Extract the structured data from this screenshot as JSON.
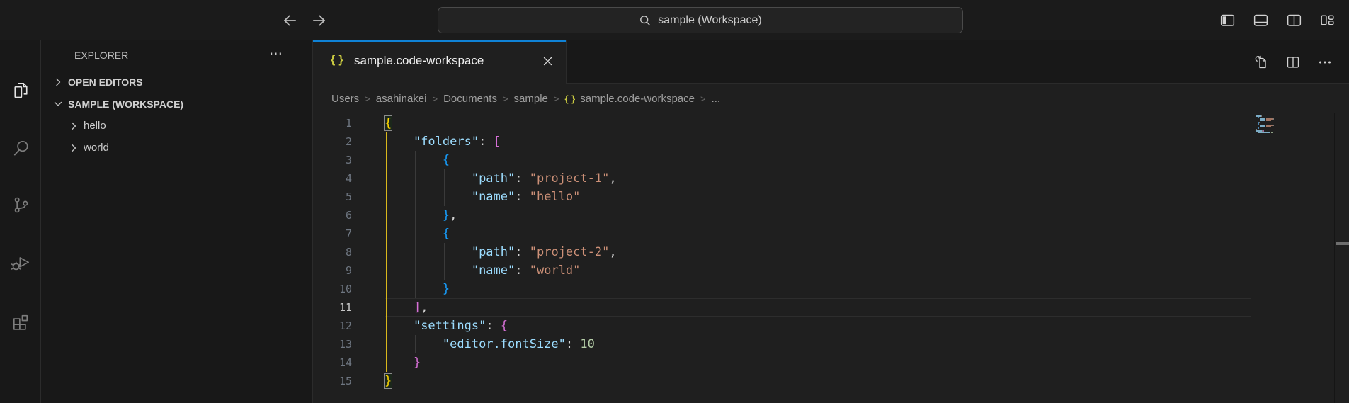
{
  "colors": {
    "accent_blue": "#0f82d6",
    "background_editor": "#1f1f1f",
    "background_shell": "#181818",
    "json_icon": "#cbcb41",
    "token_key": "#9cdcfe",
    "token_string": "#ce9178",
    "token_number": "#b5cea8",
    "bracket_yellow": "#ffd700",
    "bracket_pink": "#d670d6",
    "bracket_blue": "#179fff"
  },
  "title_bar": {
    "command_center_label": "sample (Workspace)",
    "layout_icons": [
      "toggle-primary-sidebar",
      "toggle-panel",
      "toggle-secondary-sidebar",
      "customize-layout"
    ]
  },
  "activity_bar": {
    "items": [
      {
        "name": "explorer",
        "active": true
      },
      {
        "name": "search",
        "active": false
      },
      {
        "name": "source-control",
        "active": false
      },
      {
        "name": "run-debug",
        "active": false
      },
      {
        "name": "extensions",
        "active": false
      }
    ]
  },
  "sidebar": {
    "title": "EXPLORER",
    "sections": [
      {
        "label": "OPEN EDITORS",
        "expanded": false,
        "items": []
      },
      {
        "label": "SAMPLE (WORKSPACE)",
        "expanded": true,
        "items": [
          {
            "label": "hello",
            "expanded": false
          },
          {
            "label": "world",
            "expanded": false
          }
        ]
      }
    ]
  },
  "editor": {
    "tab": {
      "label": "sample.code-workspace",
      "icon": "json-braces",
      "active": true
    },
    "actions": [
      "open-changes",
      "split-editor",
      "more-actions"
    ],
    "breadcrumbs": [
      {
        "label": "Users"
      },
      {
        "label": "asahinakei"
      },
      {
        "label": "Documents"
      },
      {
        "label": "sample"
      },
      {
        "label": "sample.code-workspace",
        "icon": "json-braces"
      },
      {
        "label": "..."
      }
    ],
    "code": {
      "language": "json",
      "current_line": 11,
      "lines": [
        {
          "n": 1,
          "guides": [],
          "tokens": [
            {
              "t": "{",
              "c": "by",
              "box": true
            }
          ]
        },
        {
          "n": 2,
          "guides": [
            {
              "col": 0,
              "active": true
            }
          ],
          "tokens": [
            {
              "t": "    "
            },
            {
              "t": "\"folders\"",
              "c": "key"
            },
            {
              "t": ":",
              "c": "pun"
            },
            {
              "t": " "
            },
            {
              "t": "[",
              "c": "bp"
            }
          ]
        },
        {
          "n": 3,
          "guides": [
            {
              "col": 0,
              "active": true
            },
            {
              "col": 4,
              "active": false
            }
          ],
          "tokens": [
            {
              "t": "        "
            },
            {
              "t": "{",
              "c": "bb"
            }
          ]
        },
        {
          "n": 4,
          "guides": [
            {
              "col": 0,
              "active": true
            },
            {
              "col": 4,
              "active": false
            },
            {
              "col": 8,
              "active": false
            }
          ],
          "tokens": [
            {
              "t": "            "
            },
            {
              "t": "\"path\"",
              "c": "key"
            },
            {
              "t": ":",
              "c": "pun"
            },
            {
              "t": " "
            },
            {
              "t": "\"project-1\"",
              "c": "str"
            },
            {
              "t": ",",
              "c": "pun"
            }
          ]
        },
        {
          "n": 5,
          "guides": [
            {
              "col": 0,
              "active": true
            },
            {
              "col": 4,
              "active": false
            },
            {
              "col": 8,
              "active": false
            }
          ],
          "tokens": [
            {
              "t": "            "
            },
            {
              "t": "\"name\"",
              "c": "key"
            },
            {
              "t": ":",
              "c": "pun"
            },
            {
              "t": " "
            },
            {
              "t": "\"hello\"",
              "c": "str"
            }
          ]
        },
        {
          "n": 6,
          "guides": [
            {
              "col": 0,
              "active": true
            },
            {
              "col": 4,
              "active": false
            }
          ],
          "tokens": [
            {
              "t": "        "
            },
            {
              "t": "}",
              "c": "bb"
            },
            {
              "t": ",",
              "c": "pun"
            }
          ]
        },
        {
          "n": 7,
          "guides": [
            {
              "col": 0,
              "active": true
            },
            {
              "col": 4,
              "active": false
            }
          ],
          "tokens": [
            {
              "t": "        "
            },
            {
              "t": "{",
              "c": "bb"
            }
          ]
        },
        {
          "n": 8,
          "guides": [
            {
              "col": 0,
              "active": true
            },
            {
              "col": 4,
              "active": false
            },
            {
              "col": 8,
              "active": false
            }
          ],
          "tokens": [
            {
              "t": "            "
            },
            {
              "t": "\"path\"",
              "c": "key"
            },
            {
              "t": ":",
              "c": "pun"
            },
            {
              "t": " "
            },
            {
              "t": "\"project-2\"",
              "c": "str"
            },
            {
              "t": ",",
              "c": "pun"
            }
          ]
        },
        {
          "n": 9,
          "guides": [
            {
              "col": 0,
              "active": true
            },
            {
              "col": 4,
              "active": false
            },
            {
              "col": 8,
              "active": false
            }
          ],
          "tokens": [
            {
              "t": "            "
            },
            {
              "t": "\"name\"",
              "c": "key"
            },
            {
              "t": ":",
              "c": "pun"
            },
            {
              "t": " "
            },
            {
              "t": "\"world\"",
              "c": "str"
            }
          ]
        },
        {
          "n": 10,
          "guides": [
            {
              "col": 0,
              "active": true
            },
            {
              "col": 4,
              "active": false
            }
          ],
          "tokens": [
            {
              "t": "        "
            },
            {
              "t": "}",
              "c": "bb"
            }
          ]
        },
        {
          "n": 11,
          "guides": [
            {
              "col": 0,
              "active": true
            }
          ],
          "tokens": [
            {
              "t": "    "
            },
            {
              "t": "]",
              "c": "bp"
            },
            {
              "t": ",",
              "c": "pun"
            }
          ]
        },
        {
          "n": 12,
          "guides": [
            {
              "col": 0,
              "active": true
            }
          ],
          "tokens": [
            {
              "t": "    "
            },
            {
              "t": "\"settings\"",
              "c": "key"
            },
            {
              "t": ":",
              "c": "pun"
            },
            {
              "t": " "
            },
            {
              "t": "{",
              "c": "bp"
            }
          ]
        },
        {
          "n": 13,
          "guides": [
            {
              "col": 0,
              "active": true
            },
            {
              "col": 4,
              "active": false
            }
          ],
          "tokens": [
            {
              "t": "        "
            },
            {
              "t": "\"editor.fontSize\"",
              "c": "key"
            },
            {
              "t": ":",
              "c": "pun"
            },
            {
              "t": " "
            },
            {
              "t": "10",
              "c": "num"
            }
          ]
        },
        {
          "n": 14,
          "guides": [
            {
              "col": 0,
              "active": true
            }
          ],
          "tokens": [
            {
              "t": "    "
            },
            {
              "t": "}",
              "c": "bp"
            }
          ]
        },
        {
          "n": 15,
          "guides": [],
          "tokens": [
            {
              "t": "}",
              "c": "by",
              "box": true
            }
          ]
        }
      ]
    }
  }
}
